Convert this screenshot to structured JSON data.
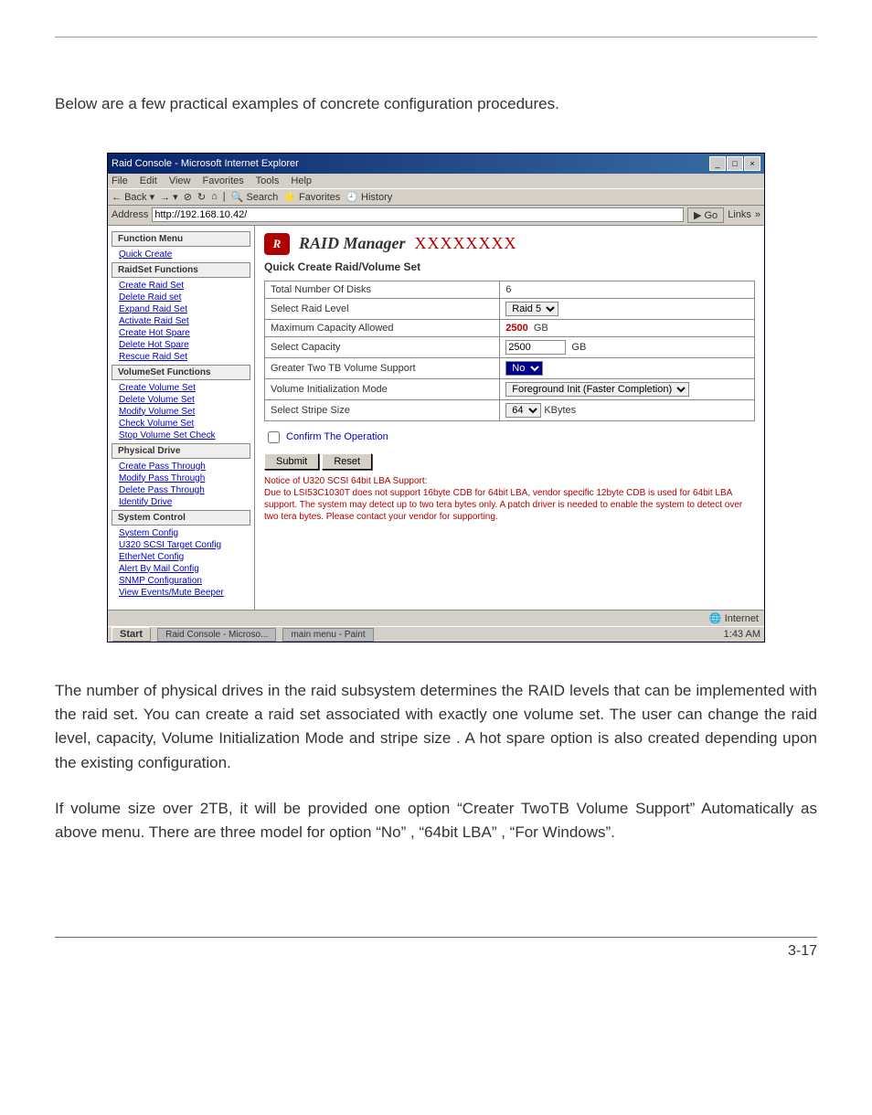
{
  "intro": "Below are a few practical examples of concrete configuration procedures.",
  "ie": {
    "title": "Raid Console - Microsoft Internet Explorer",
    "menus": [
      "File",
      "Edit",
      "View",
      "Favorites",
      "Tools",
      "Help"
    ],
    "toolbar": {
      "back": "Back",
      "search": "Search",
      "favorites": "Favorites",
      "history": "History"
    },
    "address_label": "Address",
    "address_value": "http://192.168.10.42/",
    "go": "Go",
    "links": "Links"
  },
  "sidebar": {
    "func_menu_label": "Function Menu",
    "quick_create": "Quick Create",
    "raidset_label": "RaidSet Functions",
    "raidset_items": [
      "Create Raid Set",
      "Delete Raid set",
      "Expand Raid Set",
      "Activate Raid Set",
      "Create Hot Spare",
      "Delete Hot Spare",
      "Rescue Raid Set"
    ],
    "volset_label": "VolumeSet Functions",
    "volset_items": [
      "Create Volume Set",
      "Delete Volume Set",
      "Modify Volume Set",
      "Check Volume Set",
      "Stop Volume Set Check"
    ],
    "phys_label": "Physical Drive",
    "phys_items": [
      "Create Pass Through",
      "Modify Pass Through",
      "Delete Pass Through",
      "Identify Drive"
    ],
    "sys_label": "System Control",
    "sys_items": [
      "System Config",
      "U320 SCSI Target Config",
      "EtherNet Config",
      "Alert By Mail Config",
      "SNMP Configuration",
      "View Events/Mute Beeper"
    ]
  },
  "brand": {
    "badge": "R",
    "name": "RAID ",
    "mgr": "Manager",
    "xs": "XXXXXXXX"
  },
  "panel": {
    "heading": "Quick Create Raid/Volume Set",
    "rows": {
      "total_disks_label": "Total Number Of Disks",
      "total_disks_value": "6",
      "raid_level_label": "Select Raid Level",
      "raid_level_value": "Raid 5",
      "max_cap_label": "Maximum Capacity Allowed",
      "max_cap_value": "2500",
      "max_cap_unit": "GB",
      "sel_cap_label": "Select Capacity",
      "sel_cap_value": "2500",
      "sel_cap_unit": "GB",
      "gt2tb_label": "Greater Two TB Volume Support",
      "gt2tb_value": "No",
      "init_label": "Volume Initialization Mode",
      "init_value": "Foreground Init (Faster Completion)",
      "stripe_label": "Select Stripe Size",
      "stripe_value": "64",
      "stripe_unit": "KBytes"
    },
    "confirm": "Confirm The Operation",
    "submit": "Submit",
    "reset": "Reset",
    "notice_title": "Notice of U320 SCSI 64bit LBA Support:",
    "notice_body": "Due to LSI53C1030T does not support 16byte CDB for 64bit LBA, vendor specific 12byte CDB is used for 64bit LBA support. The system may detect up to two tera bytes only. A patch driver is needed to enable the system to detect over two tera bytes. Please contact your vendor for supporting."
  },
  "status": {
    "left": "",
    "right": "Internet"
  },
  "taskbar": {
    "start": "Start",
    "task1": "Raid Console - Microso...",
    "task2": "main menu - Paint",
    "clock": "1:43 AM"
  },
  "para1": "The number of physical drives in the raid subsystem determines the RAID levels that can be implemented with the raid set. You can create a raid set associated with exactly one volume set. The user can change the raid level, capacity, Volume Initialization Mode and stripe size . A hot spare option is also created depending upon the existing configuration.",
  "para2": "If volume size over 2TB, it will be provided one option “Creater TwoTB Volume Support” Automatically as above menu. There are three model for option “No” , “64bit LBA” , “For Windows”.",
  "page_no": "3-17"
}
